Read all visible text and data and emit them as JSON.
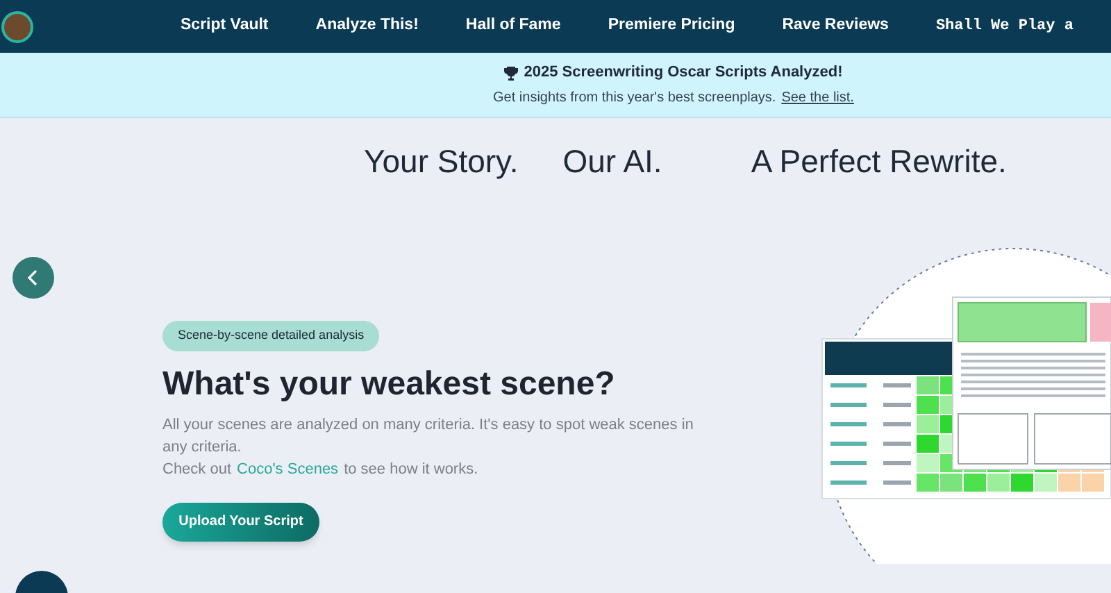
{
  "nav": {
    "links": [
      "Script Vault",
      "Analyze This!",
      "Hall of Fame",
      "Premiere Pricing",
      "Rave Reviews"
    ],
    "game_link": "Shall We Play a"
  },
  "banner": {
    "title": "2025 Screenwriting Oscar Scripts Analyzed!",
    "text": "Get insights from this year's best screenplays.",
    "link": "See the list."
  },
  "taglines": [
    "Your Story.",
    "Our AI.",
    "A Perfect Rewrite."
  ],
  "feature": {
    "badge": "Scene-by-scene detailed analysis",
    "heading": "What's your weakest scene?",
    "description": "All your scenes are analyzed on many criteria. It's easy to spot weak scenes in any criteria.",
    "cta_prefix": "Check out",
    "cta_link": "Coco's Scenes",
    "cta_suffix": "to see how it works.",
    "button": "Upload Your Script"
  }
}
